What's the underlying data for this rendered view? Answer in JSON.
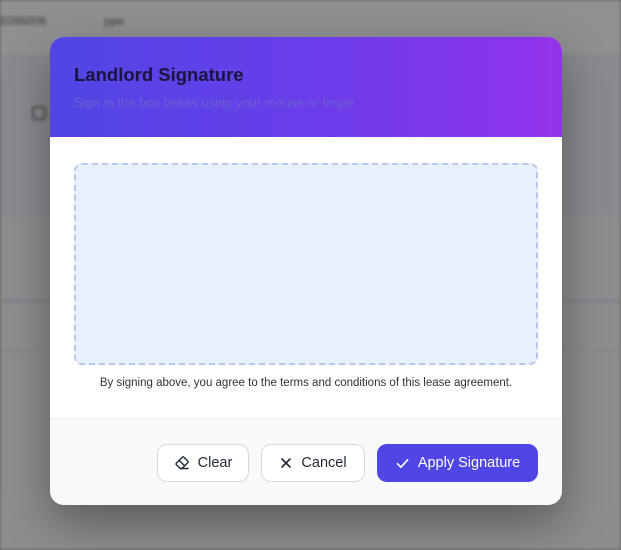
{
  "background": {
    "topbar_left": "0266006",
    "topbar_right": "ppe"
  },
  "modal": {
    "title": "Landlord Signature",
    "subtitle": "Sign in the box below using your mouse or finger",
    "agreement_note": "By signing above, you agree to the terms and conditions of this lease agreement."
  },
  "footer": {
    "clear_label": "Clear",
    "cancel_label": "Cancel",
    "apply_label": "Apply Signature"
  },
  "icons": {
    "clear": "eraser-icon",
    "cancel": "close-icon",
    "apply": "check-icon"
  },
  "colors": {
    "header_gradient_start": "#4f46e5",
    "header_gradient_end": "#9333ea",
    "primary_button": "#4f46e5",
    "signature_pad": "#e9f0fd"
  }
}
